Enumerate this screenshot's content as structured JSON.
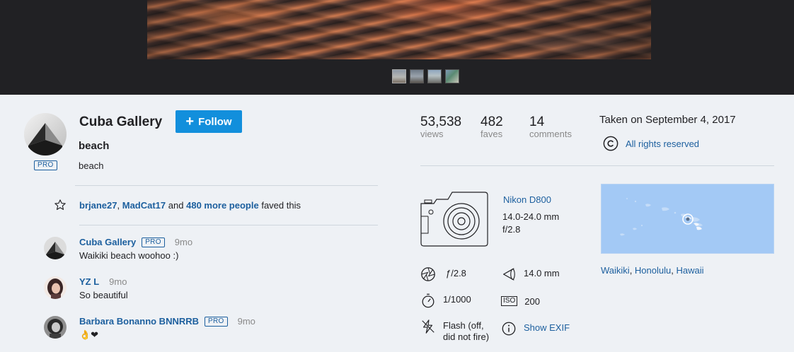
{
  "viewer": {
    "thumbnails": [
      "thumbnail-1",
      "thumbnail-2",
      "thumbnail-3",
      "thumbnail-4"
    ]
  },
  "owner": {
    "name": "Cuba Gallery",
    "badge": "PRO",
    "follow_label": "Follow"
  },
  "photo": {
    "title": "beach",
    "description": "beach"
  },
  "faves": {
    "user1": "brjane27",
    "sep": ",",
    "user2": "MadCat17",
    "and": "and",
    "more": "480 more people",
    "suffix": "faved this"
  },
  "comments": [
    {
      "author": "Cuba Gallery",
      "pro": "PRO",
      "ago": "9mo",
      "text": "Waikiki beach woohoo :)"
    },
    {
      "author": "YZ L",
      "pro": "",
      "ago": "9mo",
      "text": "So beautiful"
    },
    {
      "author": "Barbara Bonanno BNNRRB",
      "pro": "PRO",
      "ago": "9mo",
      "text": "👌❤"
    }
  ],
  "stats": {
    "views": {
      "value": "53,538",
      "label": "views"
    },
    "faves": {
      "value": "482",
      "label": "faves"
    },
    "comments": {
      "value": "14",
      "label": "comments"
    }
  },
  "taken": "Taken on September 4, 2017",
  "rights": "All rights reserved",
  "camera": {
    "model": "Nikon D800",
    "lens": "14.0-24.0 mm",
    "aperture": "f/2.8"
  },
  "exif": {
    "aperture": "ƒ/2.8",
    "focal": "14.0 mm",
    "shutter": "1/1000",
    "iso_label": "ISO",
    "iso": "200",
    "flash_line1": "Flash (off,",
    "flash_line2": "did not fire)",
    "show_exif": "Show EXIF"
  },
  "location": {
    "city": "Waikiki",
    "sep1": ", ",
    "county": "Honolulu",
    "sep2": ", ",
    "state": "Hawaii"
  },
  "colors": {
    "accent": "#128fdc",
    "link": "#1c5f9e",
    "muted": "#898989",
    "map": "#a3c9f5",
    "viewer_bg": "#212124",
    "page_bg": "#eef1f5"
  }
}
